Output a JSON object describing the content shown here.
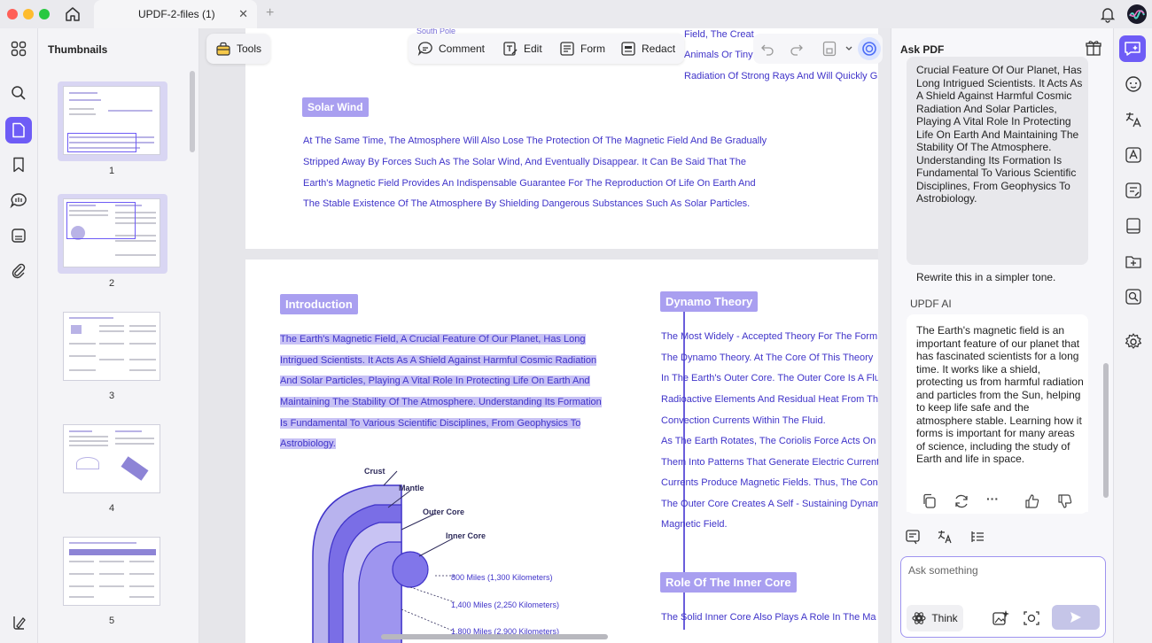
{
  "titlebar": {
    "tab_title": "UPDF-2-files (1)",
    "tab_close": "✕",
    "new_tab": "+"
  },
  "thumbnails": {
    "title": "Thumbnails",
    "pages": [
      "1",
      "2",
      "3",
      "4",
      "5"
    ],
    "selected": [
      "1",
      "2"
    ]
  },
  "toolbar": {
    "tools_label": "Tools",
    "comment_label": "Comment",
    "edit_label": "Edit",
    "form_label": "Form",
    "redact_label": "Redact"
  },
  "document": {
    "page1": {
      "crumb": "South Pole",
      "right_col": [
        "Field, The Creat",
        "Animals Or Tiny",
        "Radiation Of Strong Rays And Will Quickly G"
      ],
      "solar_heading": "Solar Wind",
      "solar_lines": [
        "At The Same Time, The Atmosphere Will Also Lose The Protection Of The Magnetic Field And Be Gradually",
        "Stripped Away By Forces Such As The Solar Wind, And Eventually Disappear. It Can Be Said That The",
        "Earth's Magnetic Field Provides An Indispensable Guarantee For The Reproduction Of Life On Earth And",
        "The Stable Existence Of The Atmosphere By Shielding Dangerous Substances Such As Solar Particles."
      ]
    },
    "page2": {
      "intro_heading": "Introduction",
      "intro_lines": [
        "The Earth's Magnetic Field, A Crucial Feature Of Our Planet, Has Long",
        "Intrigued Scientists. It Acts As A Shield Against Harmful Cosmic Radiation",
        "And Solar Particles, Playing A Vital Role In Protecting Life On Earth And",
        "Maintaining The Stability Of The Atmosphere. Understanding Its Formation",
        "Is Fundamental To Various Scientific Disciplines, From Geophysics To",
        "Astrobiology."
      ],
      "dynamo_heading": "Dynamo Theory",
      "dynamo_lines": [
        "The Most Widely - Accepted Theory For The Form",
        "The Dynamo Theory. At The Core Of This Theory",
        "In The Earth's Outer Core. The Outer Core Is A Flu",
        "Radioactive Elements And Residual Heat From Th",
        "Convection Currents Within The Fluid.",
        "As The Earth Rotates, The Coriolis Force Acts On",
        "Them Into Patterns That Generate Electric Current",
        "Currents Produce Magnetic Fields. Thus, The Con",
        "The Outer Core Creates A Self - Sustaining Dynam",
        "Magnetic Field."
      ],
      "inner_heading": "Role Of The Inner Core",
      "inner_line": "The Solid Inner Core Also Plays A Role In The Ma",
      "diagram": {
        "crust": "Crust",
        "mantle": "Mantle",
        "outer_core": "Outer Core",
        "inner_core": "Inner Core",
        "dim1": "800 Miles (1,300 Kilometers)",
        "dim2": "1,400 Miles (2,250 Kilometers)",
        "dim3": "1,800 Miles (2,900 Kilometers)"
      }
    }
  },
  "askpdf": {
    "title": "Ask PDF",
    "user_message": "Crucial Feature Of Our Planet, Has Long Intrigued Scientists. It Acts As A Shield Against Harmful Cosmic Radiation And Solar Particles, Playing A Vital Role In Protecting Life On Earth And Maintaining The Stability Of The Atmosphere. Understanding Its Formation Is Fundamental To Various Scientific Disciplines, From Geophysics To Astrobiology.",
    "user_instruction": "Rewrite this in a simpler tone.",
    "ai_label": "UPDF AI",
    "ai_message": "The Earth's magnetic field is an important feature of our planet that has fascinated scientists for a long time. It works like a shield, protecting us from harmful radiation and particles from the Sun, helping to keep life safe and the atmosphere stable. Learning how it forms is important for many areas of science, including the study of Earth and life in space.",
    "input_placeholder": "Ask something",
    "think_label": "Think",
    "more_glyph": "···"
  },
  "colors": {
    "accent": "#6e5cf6",
    "doc_text": "#3f33c9",
    "highlight": "#c8c2f5",
    "heading_pill": "#a99ff0"
  }
}
